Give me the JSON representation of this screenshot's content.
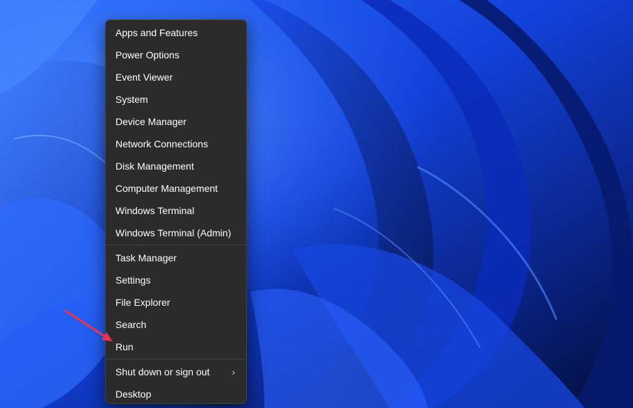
{
  "menu": {
    "groups": [
      [
        "Apps and Features",
        "Power Options",
        "Event Viewer",
        "System",
        "Device Manager",
        "Network Connections",
        "Disk Management",
        "Computer Management",
        "Windows Terminal",
        "Windows Terminal (Admin)"
      ],
      [
        "Task Manager",
        "Settings",
        "File Explorer",
        "Search",
        "Run"
      ],
      [
        "Shut down or sign out",
        "Desktop"
      ]
    ],
    "submenu_indicator": "›",
    "item_with_submenu": "Shut down or sign out"
  },
  "annotation": {
    "arrow_color": "#e8344e",
    "points_to": "Run"
  },
  "colors": {
    "menu_background": "#2b2b2b",
    "menu_text": "#ffffff",
    "wallpaper_primary": "#1e4cff",
    "wallpaper_dark": "#061a66"
  }
}
